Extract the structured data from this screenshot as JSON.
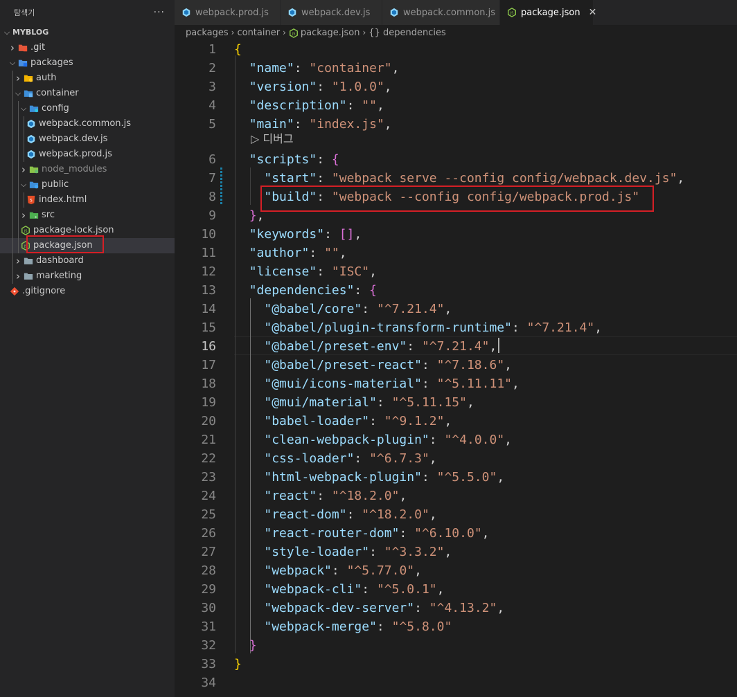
{
  "explorer": {
    "title": "탐색기",
    "more": "···",
    "tree": [
      {
        "label": "MYBLOG",
        "depth": 0,
        "chevron": "down",
        "icon": "none",
        "root": true
      },
      {
        "label": ".git",
        "depth": 1,
        "chevron": "right",
        "icon": "folder-git"
      },
      {
        "label": "packages",
        "depth": 1,
        "chevron": "down",
        "icon": "folder-packages"
      },
      {
        "label": "auth",
        "depth": 2,
        "chevron": "right",
        "icon": "folder-yellow"
      },
      {
        "label": "container",
        "depth": 2,
        "chevron": "down",
        "icon": "folder-blue"
      },
      {
        "label": "config",
        "depth": 3,
        "chevron": "down",
        "icon": "folder-config"
      },
      {
        "label": "webpack.common.js",
        "depth": 4,
        "chevron": "none",
        "icon": "webpack-file"
      },
      {
        "label": "webpack.dev.js",
        "depth": 4,
        "chevron": "none",
        "icon": "webpack-file"
      },
      {
        "label": "webpack.prod.js",
        "depth": 4,
        "chevron": "none",
        "icon": "webpack-file"
      },
      {
        "label": "node_modules",
        "depth": 3,
        "chevron": "right",
        "icon": "folder-node",
        "dim": true
      },
      {
        "label": "public",
        "depth": 3,
        "chevron": "down",
        "icon": "folder-public"
      },
      {
        "label": "index.html",
        "depth": 4,
        "chevron": "none",
        "icon": "html-file"
      },
      {
        "label": "src",
        "depth": 3,
        "chevron": "right",
        "icon": "folder-src"
      },
      {
        "label": "package-lock.json",
        "depth": 3,
        "chevron": "none",
        "icon": "node-file"
      },
      {
        "label": "package.json",
        "depth": 3,
        "chevron": "none",
        "icon": "node-file",
        "selected": true
      },
      {
        "label": "dashboard",
        "depth": 2,
        "chevron": "right",
        "icon": "folder-gray"
      },
      {
        "label": "marketing",
        "depth": 2,
        "chevron": "right",
        "icon": "folder-gray"
      },
      {
        "label": ".gitignore",
        "depth": 1,
        "chevron": "none",
        "icon": "git-file"
      }
    ]
  },
  "tabs": [
    {
      "label": "webpack.prod.js",
      "icon": "webpack-file",
      "active": false
    },
    {
      "label": "webpack.dev.js",
      "icon": "webpack-file",
      "active": false
    },
    {
      "label": "webpack.common.js",
      "icon": "webpack-file",
      "active": false
    },
    {
      "label": "package.json",
      "icon": "node-file",
      "active": true,
      "close": "✕"
    }
  ],
  "breadcrumb": [
    "packages",
    "container",
    "package.json",
    "{} dependencies"
  ],
  "codelens": "▷ 디버그",
  "current_line": 16,
  "code_lines": [
    [
      [
        "{",
        "b1"
      ]
    ],
    [
      [
        "  ",
        "p"
      ],
      [
        "\"name\"",
        "k"
      ],
      [
        ": ",
        "p"
      ],
      [
        "\"container\"",
        "s"
      ],
      [
        ",",
        "p"
      ]
    ],
    [
      [
        "  ",
        "p"
      ],
      [
        "\"version\"",
        "k"
      ],
      [
        ": ",
        "p"
      ],
      [
        "\"1.0.0\"",
        "s"
      ],
      [
        ",",
        "p"
      ]
    ],
    [
      [
        "  ",
        "p"
      ],
      [
        "\"description\"",
        "k"
      ],
      [
        ": ",
        "p"
      ],
      [
        "\"\"",
        "s"
      ],
      [
        ",",
        "p"
      ]
    ],
    [
      [
        "  ",
        "p"
      ],
      [
        "\"main\"",
        "k"
      ],
      [
        ": ",
        "p"
      ],
      [
        "\"index.js\"",
        "s"
      ],
      [
        ",",
        "p"
      ]
    ],
    [
      [
        "  ",
        "p"
      ],
      [
        "\"scripts\"",
        "k"
      ],
      [
        ": ",
        "p"
      ],
      [
        "{",
        "b2"
      ]
    ],
    [
      [
        "    ",
        "p"
      ],
      [
        "\"start\"",
        "k"
      ],
      [
        ": ",
        "p"
      ],
      [
        "\"webpack serve --config config/webpack.dev.js\"",
        "s"
      ],
      [
        ",",
        "p"
      ]
    ],
    [
      [
        "    ",
        "p"
      ],
      [
        "\"build\"",
        "k"
      ],
      [
        ": ",
        "p"
      ],
      [
        "\"webpack --config config/webpack.prod.js\"",
        "s"
      ]
    ],
    [
      [
        "  ",
        "p"
      ],
      [
        "}",
        "b2"
      ],
      [
        ",",
        "p"
      ]
    ],
    [
      [
        "  ",
        "p"
      ],
      [
        "\"keywords\"",
        "k"
      ],
      [
        ": ",
        "p"
      ],
      [
        "[",
        "b2"
      ],
      [
        "]",
        "b2"
      ],
      [
        ",",
        "p"
      ]
    ],
    [
      [
        "  ",
        "p"
      ],
      [
        "\"author\"",
        "k"
      ],
      [
        ": ",
        "p"
      ],
      [
        "\"\"",
        "s"
      ],
      [
        ",",
        "p"
      ]
    ],
    [
      [
        "  ",
        "p"
      ],
      [
        "\"license\"",
        "k"
      ],
      [
        ": ",
        "p"
      ],
      [
        "\"ISC\"",
        "s"
      ],
      [
        ",",
        "p"
      ]
    ],
    [
      [
        "  ",
        "p"
      ],
      [
        "\"dependencies\"",
        "k"
      ],
      [
        ": ",
        "p"
      ],
      [
        "{",
        "b2"
      ]
    ],
    [
      [
        "    ",
        "p"
      ],
      [
        "\"@babel/core\"",
        "k"
      ],
      [
        ": ",
        "p"
      ],
      [
        "\"^7.21.4\"",
        "s"
      ],
      [
        ",",
        "p"
      ]
    ],
    [
      [
        "    ",
        "p"
      ],
      [
        "\"@babel/plugin-transform-runtime\"",
        "k"
      ],
      [
        ": ",
        "p"
      ],
      [
        "\"^7.21.4\"",
        "s"
      ],
      [
        ",",
        "p"
      ]
    ],
    [
      [
        "    ",
        "p"
      ],
      [
        "\"@babel/preset-env\"",
        "k"
      ],
      [
        ": ",
        "p"
      ],
      [
        "\"^7.21.4\"",
        "s"
      ],
      [
        ",",
        "p"
      ]
    ],
    [
      [
        "    ",
        "p"
      ],
      [
        "\"@babel/preset-react\"",
        "k"
      ],
      [
        ": ",
        "p"
      ],
      [
        "\"^7.18.6\"",
        "s"
      ],
      [
        ",",
        "p"
      ]
    ],
    [
      [
        "    ",
        "p"
      ],
      [
        "\"@mui/icons-material\"",
        "k"
      ],
      [
        ": ",
        "p"
      ],
      [
        "\"^5.11.11\"",
        "s"
      ],
      [
        ",",
        "p"
      ]
    ],
    [
      [
        "    ",
        "p"
      ],
      [
        "\"@mui/material\"",
        "k"
      ],
      [
        ": ",
        "p"
      ],
      [
        "\"^5.11.15\"",
        "s"
      ],
      [
        ",",
        "p"
      ]
    ],
    [
      [
        "    ",
        "p"
      ],
      [
        "\"babel-loader\"",
        "k"
      ],
      [
        ": ",
        "p"
      ],
      [
        "\"^9.1.2\"",
        "s"
      ],
      [
        ",",
        "p"
      ]
    ],
    [
      [
        "    ",
        "p"
      ],
      [
        "\"clean-webpack-plugin\"",
        "k"
      ],
      [
        ": ",
        "p"
      ],
      [
        "\"^4.0.0\"",
        "s"
      ],
      [
        ",",
        "p"
      ]
    ],
    [
      [
        "    ",
        "p"
      ],
      [
        "\"css-loader\"",
        "k"
      ],
      [
        ": ",
        "p"
      ],
      [
        "\"^6.7.3\"",
        "s"
      ],
      [
        ",",
        "p"
      ]
    ],
    [
      [
        "    ",
        "p"
      ],
      [
        "\"html-webpack-plugin\"",
        "k"
      ],
      [
        ": ",
        "p"
      ],
      [
        "\"^5.5.0\"",
        "s"
      ],
      [
        ",",
        "p"
      ]
    ],
    [
      [
        "    ",
        "p"
      ],
      [
        "\"react\"",
        "k"
      ],
      [
        ": ",
        "p"
      ],
      [
        "\"^18.2.0\"",
        "s"
      ],
      [
        ",",
        "p"
      ]
    ],
    [
      [
        "    ",
        "p"
      ],
      [
        "\"react-dom\"",
        "k"
      ],
      [
        ": ",
        "p"
      ],
      [
        "\"^18.2.0\"",
        "s"
      ],
      [
        ",",
        "p"
      ]
    ],
    [
      [
        "    ",
        "p"
      ],
      [
        "\"react-router-dom\"",
        "k"
      ],
      [
        ": ",
        "p"
      ],
      [
        "\"^6.10.0\"",
        "s"
      ],
      [
        ",",
        "p"
      ]
    ],
    [
      [
        "    ",
        "p"
      ],
      [
        "\"style-loader\"",
        "k"
      ],
      [
        ": ",
        "p"
      ],
      [
        "\"^3.3.2\"",
        "s"
      ],
      [
        ",",
        "p"
      ]
    ],
    [
      [
        "    ",
        "p"
      ],
      [
        "\"webpack\"",
        "k"
      ],
      [
        ": ",
        "p"
      ],
      [
        "\"^5.77.0\"",
        "s"
      ],
      [
        ",",
        "p"
      ]
    ],
    [
      [
        "    ",
        "p"
      ],
      [
        "\"webpack-cli\"",
        "k"
      ],
      [
        ": ",
        "p"
      ],
      [
        "\"^5.0.1\"",
        "s"
      ],
      [
        ",",
        "p"
      ]
    ],
    [
      [
        "    ",
        "p"
      ],
      [
        "\"webpack-dev-server\"",
        "k"
      ],
      [
        ": ",
        "p"
      ],
      [
        "\"^4.13.2\"",
        "s"
      ],
      [
        ",",
        "p"
      ]
    ],
    [
      [
        "    ",
        "p"
      ],
      [
        "\"webpack-merge\"",
        "k"
      ],
      [
        ": ",
        "p"
      ],
      [
        "\"^5.8.0\"",
        "s"
      ]
    ],
    [
      [
        "  ",
        "p"
      ],
      [
        "}",
        "b2"
      ]
    ],
    [
      [
        "}",
        "b1"
      ]
    ],
    []
  ],
  "colors": {
    "key": "#9cdcfe",
    "string": "#ce9178",
    "bracket1": "#ffd700",
    "bracket2": "#da70d6",
    "highlight": "#d51f26"
  }
}
